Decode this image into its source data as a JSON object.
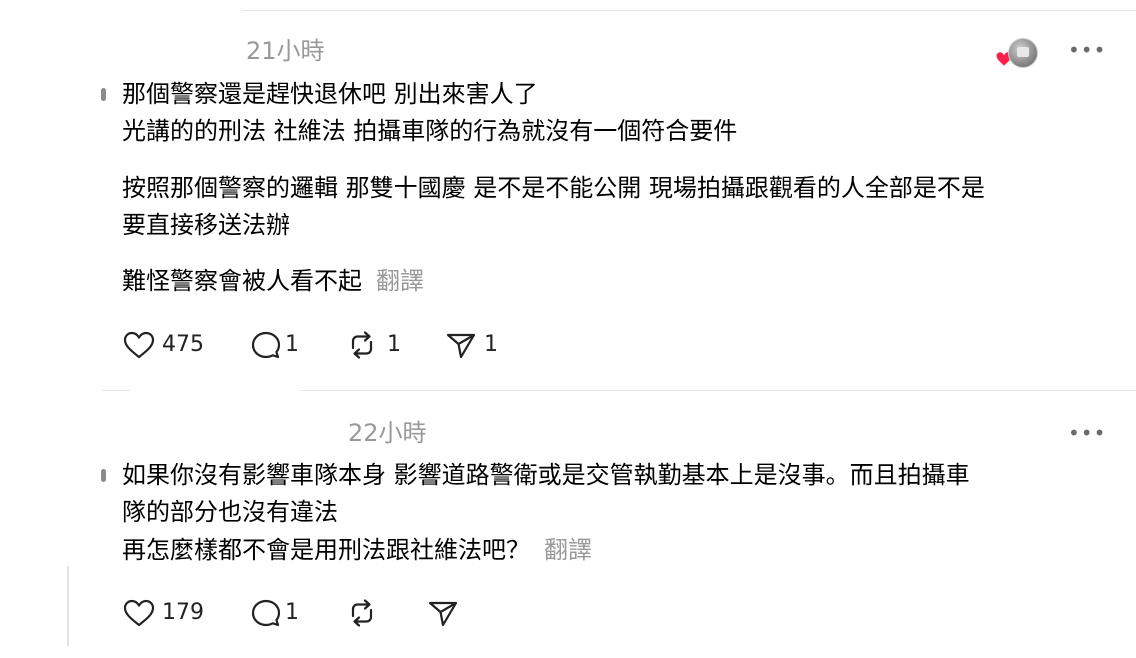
{
  "comments": [
    {
      "time": "21小時",
      "lines": [
        "那個警察還是趕快退休吧 別出來害人了",
        "光講的的刑法 社維法 拍攝車隊的行為就沒有一個符合要件",
        "按照那個警察的邏輯 那雙十國慶 是不是不能公開 現場拍攝跟觀看的人全部是不是",
        "要直接移送法辦",
        "難怪警察會被人看不起"
      ],
      "translate_label": "翻譯",
      "likes": "475",
      "replies": "1",
      "reposts": "1",
      "shares": "1",
      "more_label": "•••"
    },
    {
      "time": "22小時",
      "lines": [
        "如果你沒有影響車隊本身 影響道路警衛或是交管執勤基本上是沒事。而且拍攝車",
        "隊的部分也沒有違法",
        "再怎麼樣都不會是用刑法跟社維法吧？"
      ],
      "translate_label": "翻譯",
      "likes": "179",
      "replies": "1",
      "more_label": "•••"
    }
  ],
  "icons": {
    "like": "heart-icon",
    "reply": "comment-icon",
    "repost": "repost-icon",
    "share": "send-icon",
    "more": "more-icon",
    "liked_badge": "heart-badge-icon",
    "avatar": "avatar"
  },
  "colors": {
    "text": "#000000",
    "muted": "#999999",
    "badge_heart": "#ff1f4b",
    "divider": "#e6e6e6"
  }
}
